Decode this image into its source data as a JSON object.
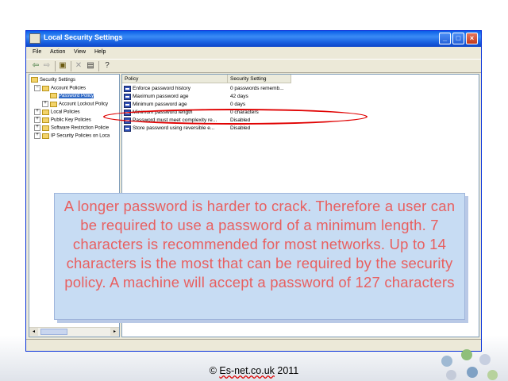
{
  "window": {
    "title": "Local Security Settings",
    "controls": [
      "_",
      "□",
      "×"
    ]
  },
  "menubar": [
    "File",
    "Action",
    "View",
    "Help"
  ],
  "toolbar": {
    "icons": [
      "back-arrow-icon",
      "forward-arrow-icon",
      "up-folder-icon",
      "delete-icon",
      "properties-icon",
      "help-icon"
    ]
  },
  "tree": {
    "root": "Security Settings",
    "items": [
      {
        "label": "Account Policies",
        "expander": "−"
      },
      {
        "label": "Password Policy",
        "selected": true
      },
      {
        "label": "Account Lockout Policy",
        "expander": "+"
      },
      {
        "label": "Local Policies",
        "expander": "+"
      },
      {
        "label": "Public Key Policies",
        "expander": "+"
      },
      {
        "label": "Software Restriction Policie",
        "expander": "+"
      },
      {
        "label": "IP Security Policies on Loca",
        "expander": "+"
      }
    ]
  },
  "list": {
    "columns": [
      "Policy",
      "Security Setting"
    ],
    "rows": [
      {
        "policy": "Enforce password history",
        "setting": "0 passwords rememb..."
      },
      {
        "policy": "Maximum password age",
        "setting": "42 days"
      },
      {
        "policy": "Minimum password age",
        "setting": "0 days"
      },
      {
        "policy": "Minimum password length",
        "setting": "0 characters"
      },
      {
        "policy": "Password must meet complexity re...",
        "setting": "Disabled"
      },
      {
        "policy": "Store password using reversible e...",
        "setting": "Disabled"
      }
    ]
  },
  "callout": {
    "text": "A longer password is harder to crack. Therefore a user can be required to use a password of a minimum length.  7 characters is recommended for most networks. Up to 14 characters is the most that can be required by the security policy. A machine will accept a password of 127 characters"
  },
  "footer": {
    "prefix": "© ",
    "brand": "Es-net.co.uk",
    "suffix": " 2011"
  },
  "colors": {
    "titlebar": "#0a5ee8",
    "callout_bg": "#c7dcf3",
    "callout_text": "#e86060",
    "highlight_ellipse": "#e00000",
    "selection": "#316ac5"
  }
}
